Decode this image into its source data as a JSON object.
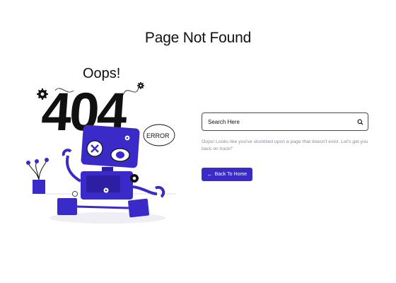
{
  "page": {
    "title": "Page Not Found"
  },
  "illustration": {
    "oops_text": "Oops!",
    "big_number": "404",
    "error_label": "ERROR"
  },
  "search": {
    "placeholder": "Search Here",
    "value": "",
    "icon": "search-icon"
  },
  "message": "Oops! Looks like you've stumbled upon a page that doesn't exist. Let's get you back on track!\"",
  "back_button": {
    "label": "Back To Home",
    "icon": "arrow-left-icon"
  },
  "colors": {
    "accent": "#3a2ac7",
    "robot": "#3a2ac7",
    "text": "#111111",
    "muted": "#8a8a9a"
  }
}
